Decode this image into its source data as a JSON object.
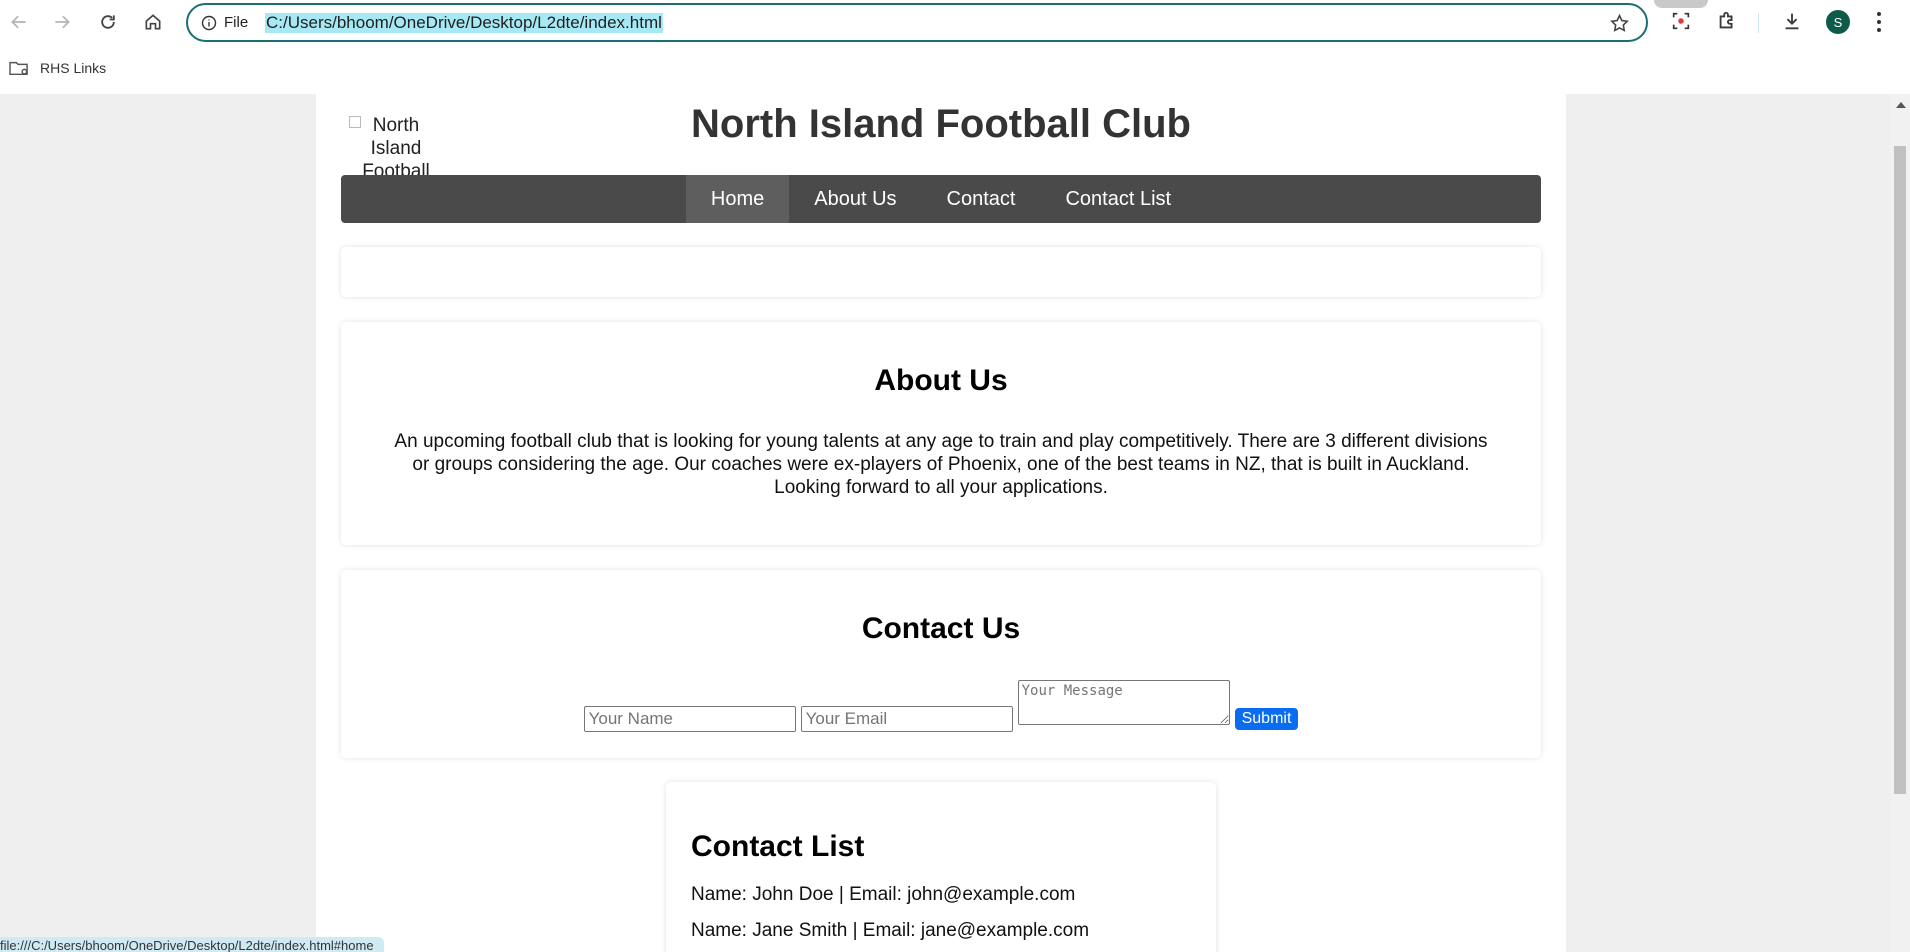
{
  "browser": {
    "url": "C:/Users/bhoom/OneDrive/Desktop/L2dte/index.html",
    "scheme_chip": "File",
    "profile_initial": "S",
    "bookmarks": [
      {
        "label": "RHS Links"
      }
    ],
    "status_url": "file:///C:/Users/bhoom/OneDrive/Desktop/L2dte/index.html#home"
  },
  "site": {
    "title": "North Island Football Club",
    "logo_alt": "North Island Football Club Logo",
    "nav": [
      {
        "label": "Home",
        "active": true
      },
      {
        "label": "About Us"
      },
      {
        "label": "Contact"
      },
      {
        "label": "Contact List"
      }
    ]
  },
  "about": {
    "heading": "About Us",
    "text": "An upcoming football club that is looking for young talents at any age to train and play competitively. There are 3 different divisions or groups considering the age. Our coaches were ex-players of Phoenix, one of the best teams in NZ, that is built in Auckland. Looking forward to all your applications."
  },
  "contact": {
    "heading": "Contact Us",
    "name_placeholder": "Your Name",
    "email_placeholder": "Your Email",
    "message_placeholder": "Your Message",
    "submit_label": "Submit"
  },
  "contact_list": {
    "heading": "Contact List",
    "entries": [
      "Name: John Doe | Email: john@example.com",
      "Name: Jane Smith | Email: jane@example.com"
    ]
  },
  "colors": {
    "navbar": "#4a4a4a",
    "submit": "#0a6cf0",
    "omnibox_border": "#1a6f73",
    "url_highlight": "#a7e8f5"
  }
}
